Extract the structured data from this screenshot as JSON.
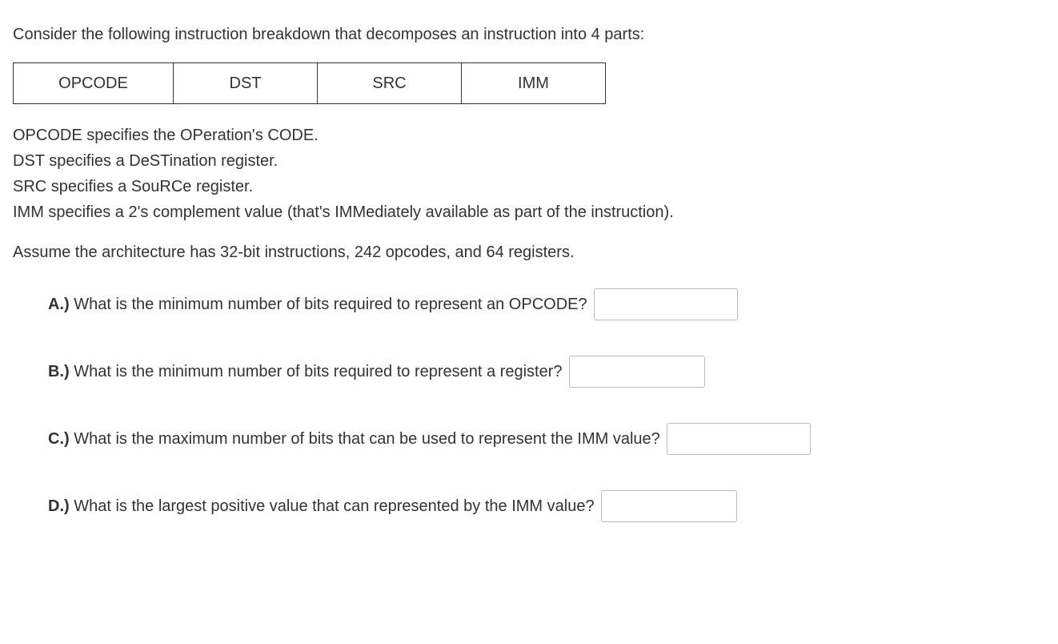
{
  "intro": "Consider the following instruction breakdown that decomposes an instruction into 4 parts:",
  "table": {
    "opcode": "OPCODE",
    "dst": "DST",
    "src": "SRC",
    "imm": "IMM"
  },
  "definitions": {
    "opcode": "OPCODE specifies the OPeration's CODE.",
    "dst": "DST specifies a DeSTination register.",
    "src": "SRC specifies a SouRCe register.",
    "imm": "IMM specifies a 2's complement value (that's IMMediately available as part of the instruction)."
  },
  "assumption": "Assume the architecture has 32-bit instructions, 242 opcodes, and 64 registers.",
  "questions": {
    "a": {
      "label": "A.)",
      "text": " What is the minimum number of bits required to represent an OPCODE? "
    },
    "b": {
      "label": "B.)",
      "text": " What is the minimum number of bits required to represent a register? "
    },
    "c": {
      "label": "C.)",
      "text": " What is the maximum number of bits that can be used to represent the IMM value? "
    },
    "d": {
      "label": "D.)",
      "text": " What is the largest positive value that can represented by the IMM value? "
    }
  }
}
